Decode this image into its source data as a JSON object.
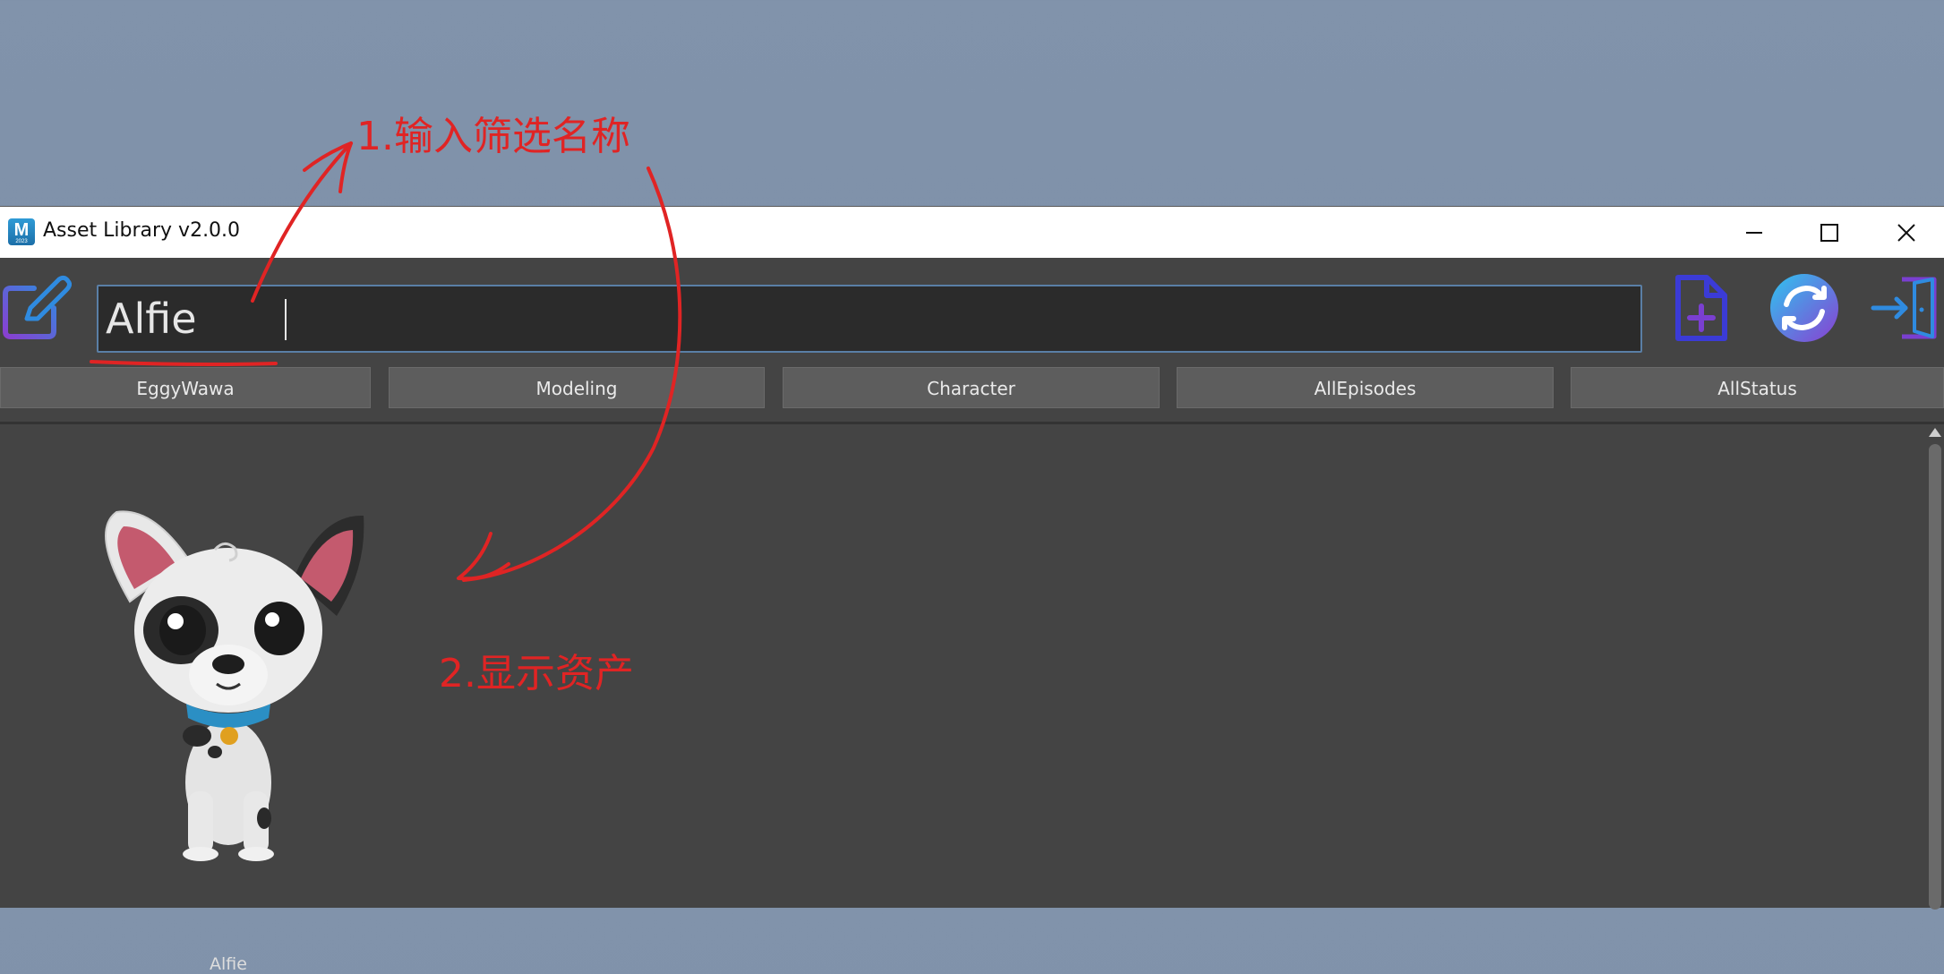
{
  "annotations": {
    "step1": "1.输入筛选名称",
    "step2": "2.显示资产"
  },
  "window": {
    "title": "Asset Library v2.0.0",
    "app_icon": {
      "letter": "M",
      "sub": "2023"
    }
  },
  "toolbar": {
    "search": {
      "value": "Alfie",
      "placeholder": ""
    }
  },
  "filters": [
    "EggyWawa",
    "Modeling",
    "Character",
    "AllEpisodes",
    "AllStatus"
  ],
  "assets": [
    {
      "name": "Alfie"
    }
  ],
  "colors": {
    "annotation": "#e02424",
    "panel_bg": "#444444",
    "filter_bg": "#5d5d5d",
    "search_bg": "#2b2b2b"
  }
}
